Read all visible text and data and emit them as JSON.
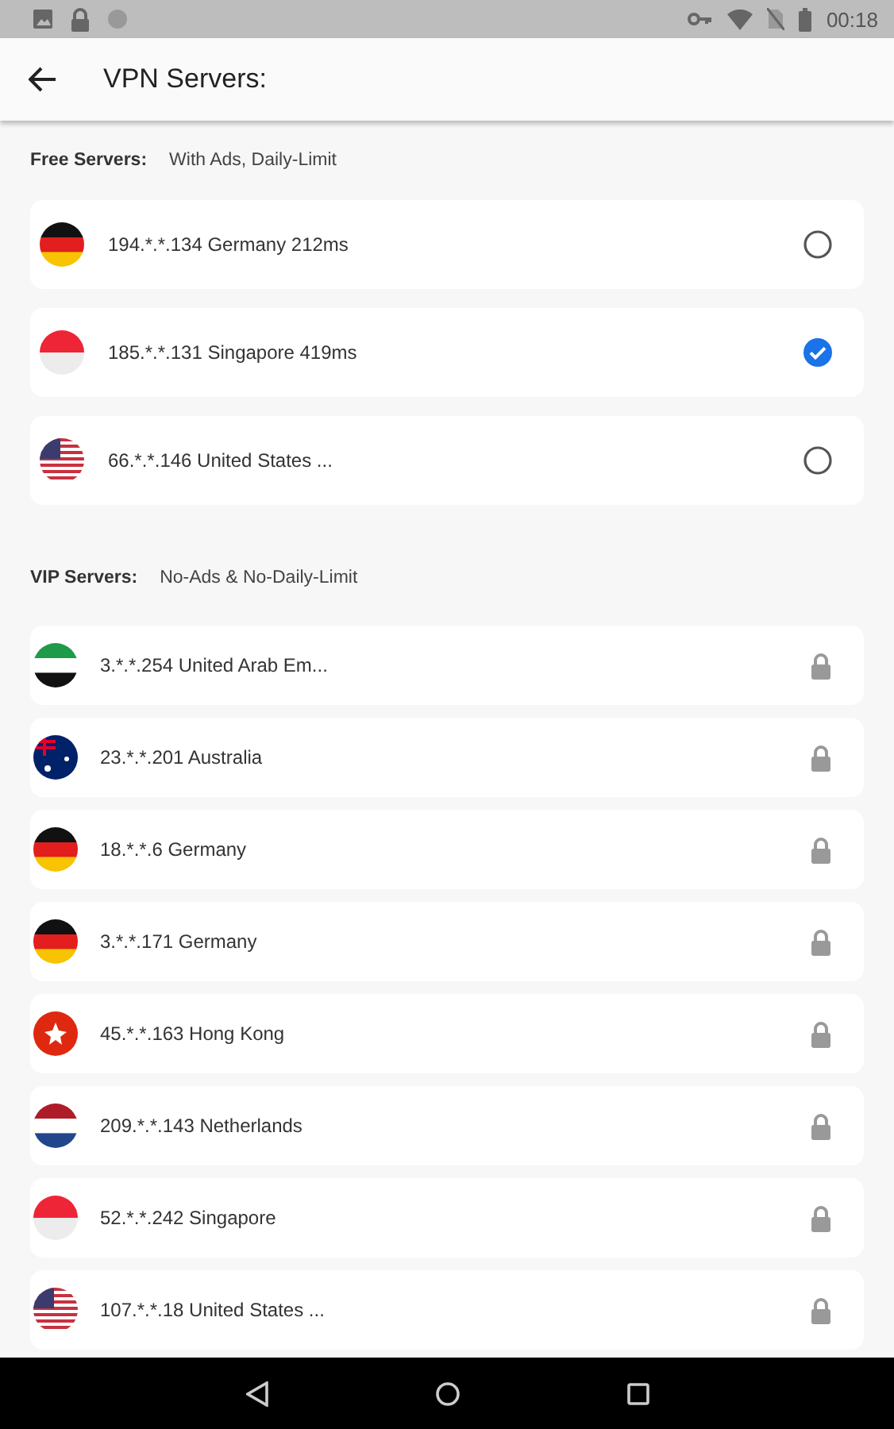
{
  "status_bar": {
    "time": "00:18"
  },
  "app_bar": {
    "title": "VPN Servers:"
  },
  "free_section": {
    "title": "Free Servers:",
    "subtitle": "With Ads, Daily-Limit",
    "servers": [
      {
        "kind": "de",
        "label": "194.*.*.134 Germany 212ms",
        "selected": false
      },
      {
        "kind": "sg",
        "label": "185.*.*.131 Singapore 419ms",
        "selected": true
      },
      {
        "kind": "us",
        "label": "66.*.*.146 United States ...",
        "selected": false
      }
    ]
  },
  "vip_section": {
    "title": "VIP Servers:",
    "subtitle": "No-Ads & No-Daily-Limit",
    "servers": [
      {
        "kind": "ae",
        "label": "3.*.*.254 United Arab Em..."
      },
      {
        "kind": "au",
        "label": "23.*.*.201 Australia"
      },
      {
        "kind": "de",
        "label": "18.*.*.6 Germany"
      },
      {
        "kind": "de",
        "label": "3.*.*.171 Germany"
      },
      {
        "kind": "hk",
        "label": "45.*.*.163 Hong Kong"
      },
      {
        "kind": "nl",
        "label": "209.*.*.143 Netherlands"
      },
      {
        "kind": "sg",
        "label": "52.*.*.242 Singapore"
      },
      {
        "kind": "us",
        "label": "107.*.*.18 United States ..."
      }
    ]
  }
}
